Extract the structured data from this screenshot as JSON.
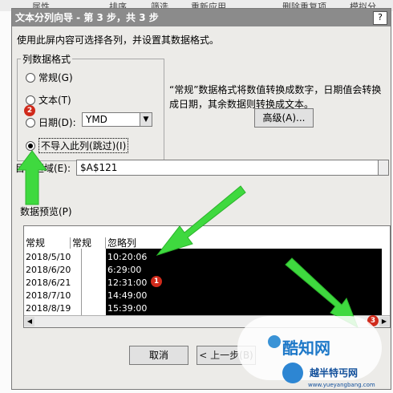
{
  "background": {
    "toolbar_items": [
      "属性",
      "排序",
      "筛选",
      "重新应用",
      "删除重复项",
      "模拟分"
    ]
  },
  "dialog": {
    "title": "文本分列向导 - 第 3 步，共 3 步",
    "close_label": "?",
    "instruction": "使用此屏内容可选择各列，并设置其数据格式。",
    "format_group": {
      "legend": "列数据格式",
      "options": [
        {
          "label": "常规(G)",
          "selected": false
        },
        {
          "label": "文本(T)",
          "selected": false
        },
        {
          "label": "日期(D):",
          "selected": false
        },
        {
          "label": "不导入此列(跳过)(I)",
          "selected": true
        }
      ],
      "date_format": "YMD"
    },
    "description": "“常规”数据格式将数值转换成数字，日期值会转换成日期，其余数据则转换成文本。",
    "advanced_button": "高级(A)...",
    "target_label": "目标区域(E):",
    "target_value": "$A$121",
    "preview_label": "数据预览(P)",
    "preview": {
      "headers": [
        "常规",
        "常规",
        "忽略列"
      ],
      "rows": [
        [
          "2018/5/10",
          "10:20:06"
        ],
        [
          "2018/6/20",
          "6:29:00"
        ],
        [
          "2018/6/21",
          "12:31:00"
        ],
        [
          "2018/7/10",
          "14:49:00"
        ],
        [
          "2018/8/19",
          "15:39:00"
        ]
      ]
    },
    "cancel_button": "取消",
    "back_button": "< 上一步(B)"
  },
  "annotations": {
    "markers": [
      "1",
      "2",
      "3"
    ],
    "arrow_color": "#3fd93f"
  },
  "watermark": {
    "brand": "酷知网",
    "brand2": "越半特丐网",
    "url": "www.yueyangbang.com"
  }
}
